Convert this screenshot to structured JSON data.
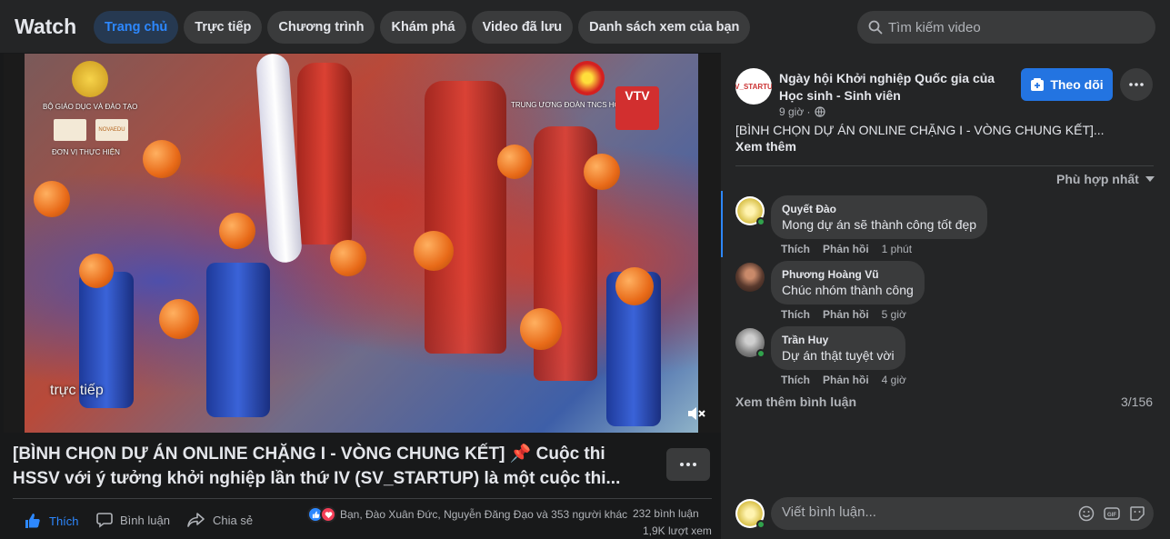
{
  "header": {
    "title": "Watch",
    "tabs": [
      {
        "label": "Trang chủ",
        "active": true
      },
      {
        "label": "Trực tiếp"
      },
      {
        "label": "Chương trình"
      },
      {
        "label": "Khám phá"
      },
      {
        "label": "Video đã lưu"
      },
      {
        "label": "Danh sách xem của bạn"
      }
    ],
    "search_placeholder": "Tìm kiếm video"
  },
  "video": {
    "logo_left_caption": "BỘ GIÁO DỤC VÀ ĐÀO TẠO",
    "sponsor_caption": "ĐƠN VỊ THỰC HIỆN",
    "sponsor_label": "NOVAEDU VN",
    "logo_right_caption": "TRUNG ƯƠNG ĐOÀN TNCS HỒ CHÍ MINH",
    "channel_badge": "VTV",
    "live_text": "trực tiếp",
    "title": "[BÌNH CHỌN DỰ ÁN ONLINE CHẶNG I - VÒNG CHUNG KẾT] 📌 Cuộc thi HSSV với ý tưởng khởi nghiệp lần thứ IV (SV_STARTUP) là một cuộc thi..."
  },
  "actions": {
    "like": "Thích",
    "comment": "Bình luận",
    "share": "Chia sẻ",
    "reactions_text": "Bạn, Đào Xuân Đức, Nguyễn Đăng Đạo và 353 người khác",
    "comment_count": "232 bình luận",
    "view_count": "1,9K lượt xem"
  },
  "panel": {
    "page_avatar_text": "SV_STARTUP",
    "page_name": "Ngày hội Khởi nghiệp Quốc gia của Học sinh - Sinh viên",
    "follow_label": "Theo dõi",
    "time": "9 giờ ·",
    "post_text": "[BÌNH CHỌN DỰ ÁN ONLINE CHẶNG I - VÒNG CHUNG KẾT]...",
    "see_more": "Xem thêm",
    "sort_label": "Phù hợp nhất",
    "comments": [
      {
        "name": "Quyết Đào",
        "text": "Mong dự án sẽ thành công tốt đẹp",
        "like": "Thích",
        "reply": "Phản hồi",
        "time": "1 phút"
      },
      {
        "name": "Phương Hoàng Vũ",
        "text": "Chúc nhóm thành công",
        "like": "Thích",
        "reply": "Phản hồi",
        "time": "5 giờ"
      },
      {
        "name": "Trần Huy",
        "text": "Dự án thật tuyệt vời",
        "like": "Thích",
        "reply": "Phản hồi",
        "time": "4 giờ"
      }
    ],
    "more_comments": "Xem thêm bình luận",
    "comments_total": "3/156",
    "composer_placeholder": "Viết bình luận..."
  },
  "colors": {
    "background": "#18191a",
    "surface": "#242526",
    "accent": "#2d88ff",
    "follow_button": "#2374e1",
    "online": "#31a24c"
  }
}
